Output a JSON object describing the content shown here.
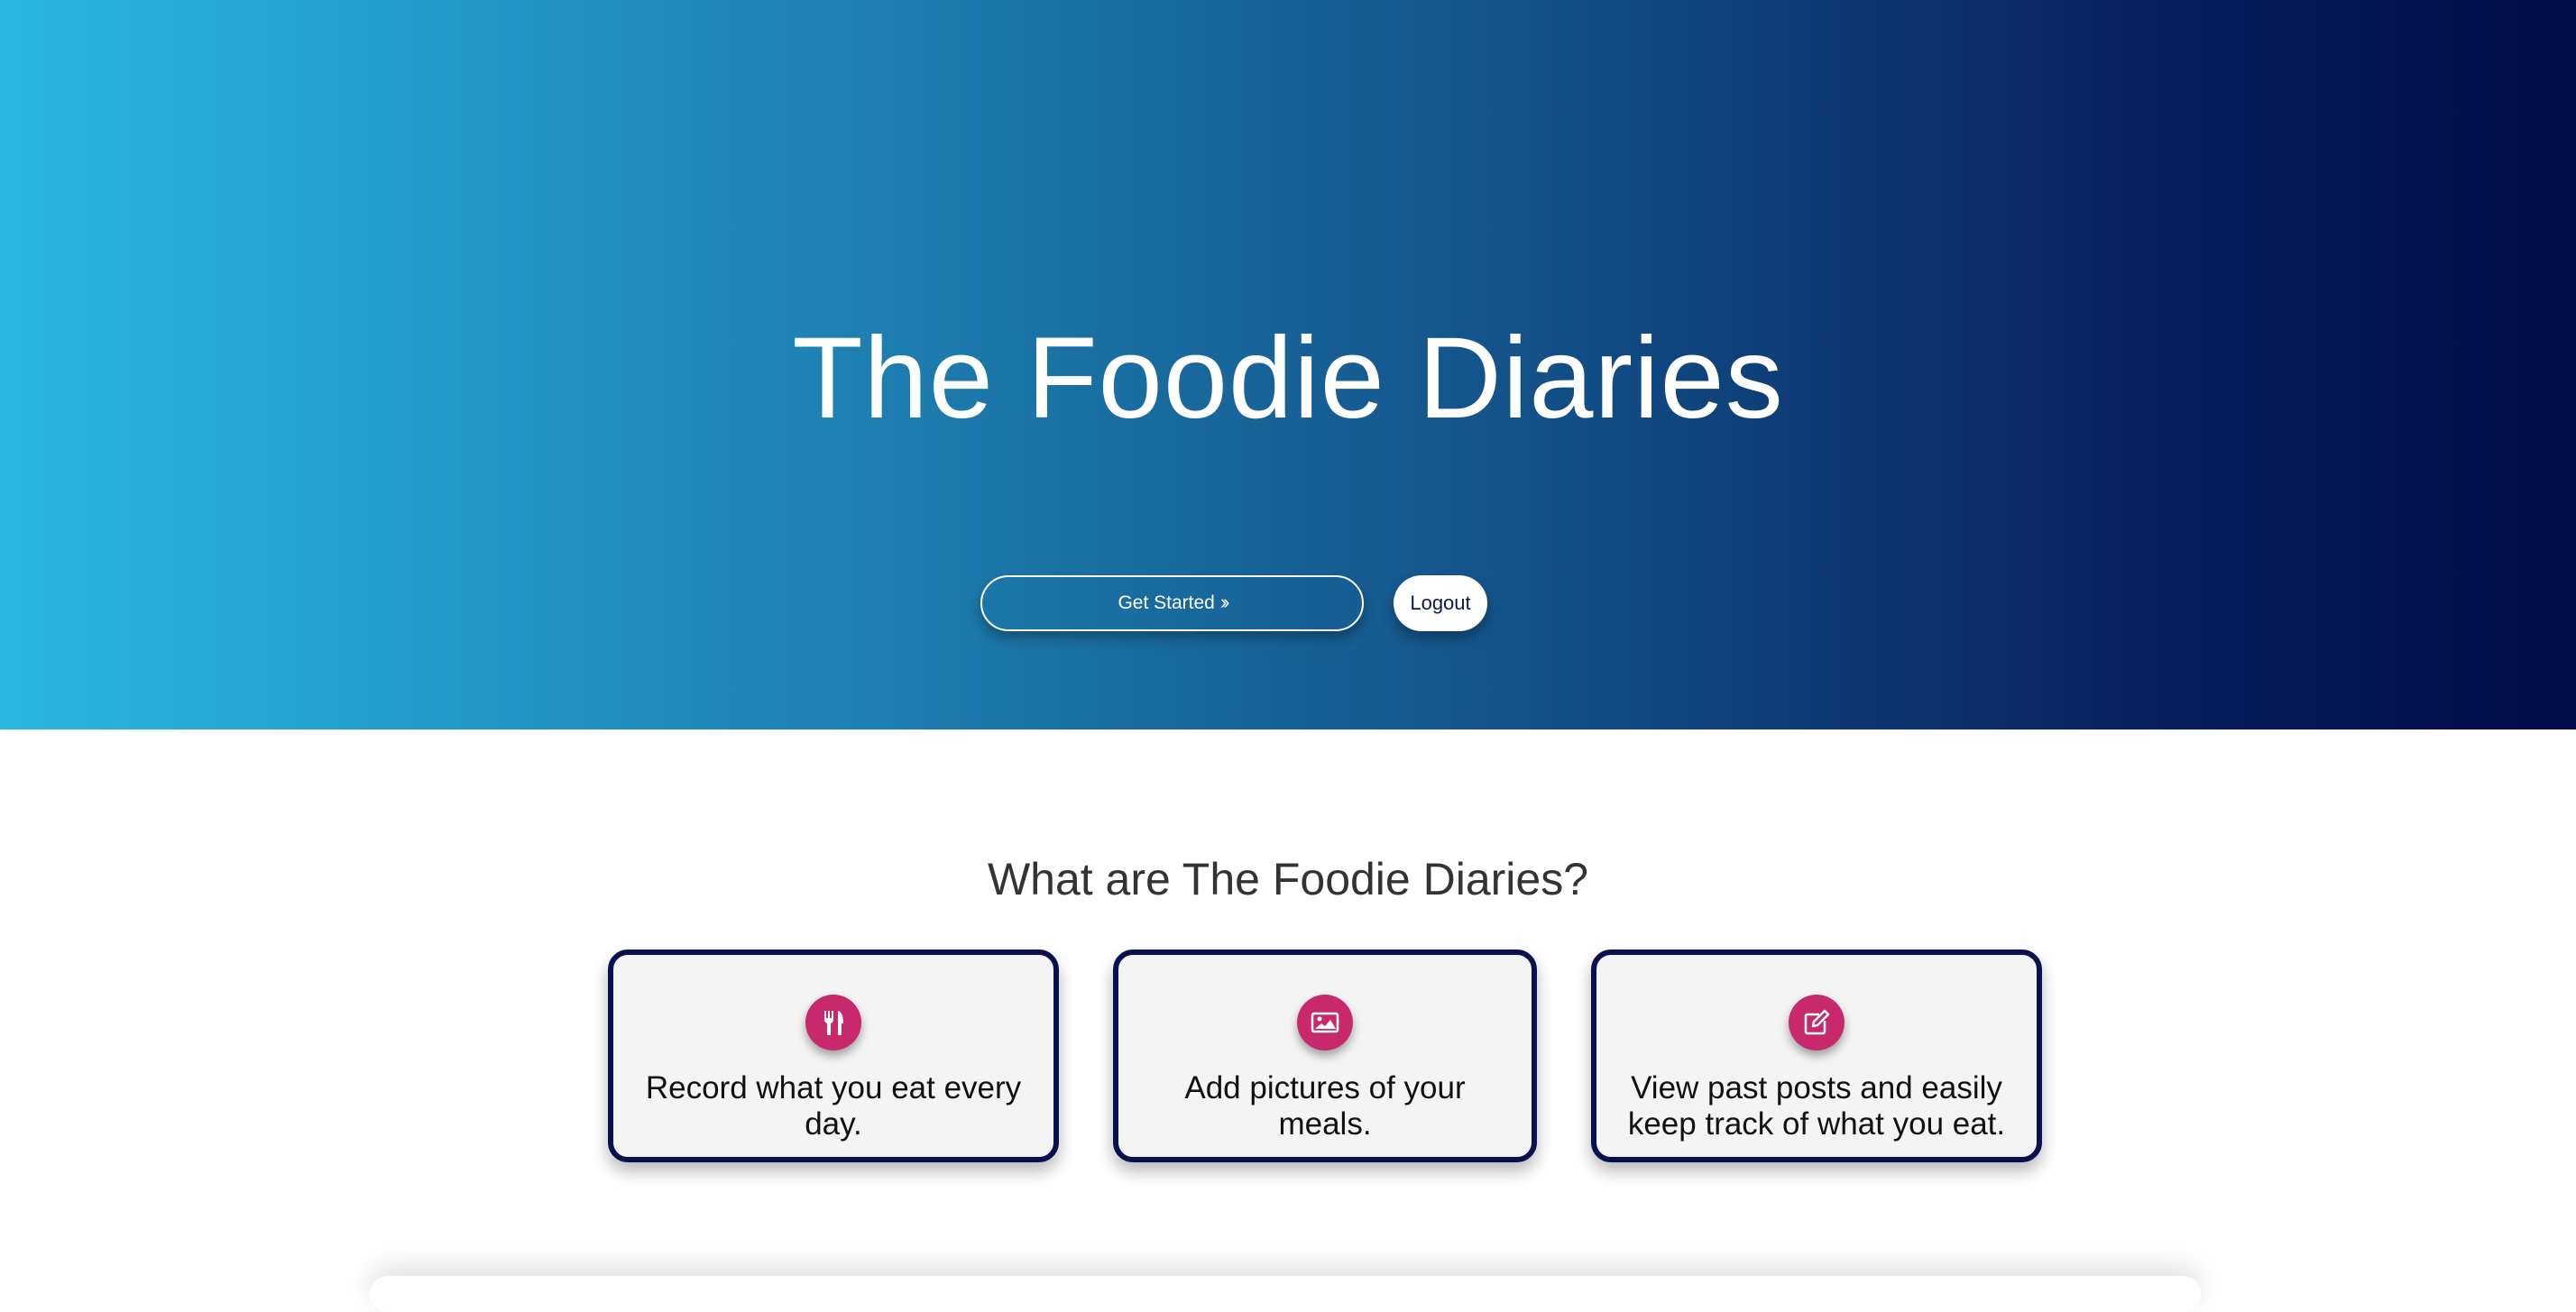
{
  "hero": {
    "title": "The Foodie Diaries",
    "get_started_label": "Get Started",
    "get_started_icon": "double-chevron-right-icon",
    "logout_label": "Logout",
    "gradient_colors": [
      "#29b6df",
      "#1f86b6",
      "#124c84",
      "#071d5c",
      "#030c48"
    ]
  },
  "features": {
    "heading": "What are The Foodie Diaries?",
    "accent_color": "#c8296c",
    "border_color": "#0a0f4d",
    "cards": [
      {
        "icon": "utensils-icon",
        "text": "Record what you eat every day."
      },
      {
        "icon": "image-icon",
        "text": "Add pictures of your meals."
      },
      {
        "icon": "edit-icon",
        "text": "View past posts and easily keep track of what you eat."
      }
    ]
  }
}
